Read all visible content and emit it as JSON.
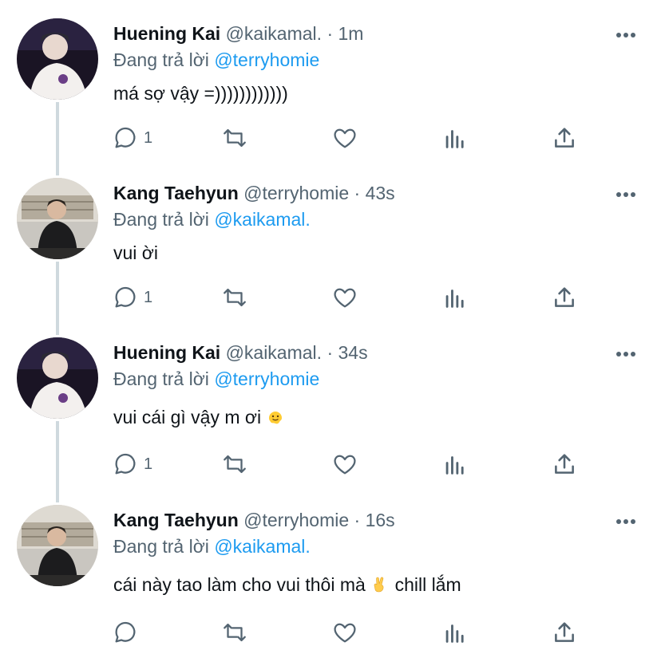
{
  "colors": {
    "link": "#1d9bf0",
    "muted": "#536471",
    "text": "#0f1419",
    "thread_line": "#cfd9de"
  },
  "reply_prefix": "Đang trả lời",
  "tweets": [
    {
      "name": "Huening Kai",
      "handle": "@kaikamal.",
      "time": "· 1m",
      "reply_to": "@terryhomie",
      "text": "má sợ vậy =))))))))))))",
      "emoji": "",
      "text_after": "",
      "reply_count": "1",
      "avatar_icon": "avatar-photo"
    },
    {
      "name": "Kang Taehyun",
      "handle": "@terryhomie",
      "time": "· 43s",
      "reply_to": "@kaikamal.",
      "text": "vui ời",
      "emoji": "",
      "text_after": "",
      "reply_count": "1",
      "avatar_icon": "avatar-photo"
    },
    {
      "name": "Huening Kai",
      "handle": "@kaikamal.",
      "time": "· 34s",
      "reply_to": "@terryhomie",
      "text": "vui cái gì vậy m ơi",
      "emoji": "melting-face-emoji",
      "text_after": "",
      "reply_count": "1",
      "avatar_icon": "avatar-photo"
    },
    {
      "name": "Kang Taehyun",
      "handle": "@terryhomie",
      "time": "· 16s",
      "reply_to": "@kaikamal.",
      "text": "cái này tao làm cho vui thôi mà",
      "emoji": "crossed-fingers-emoji",
      "text_after": "chill lắm",
      "reply_count": "",
      "avatar_icon": "avatar-photo"
    }
  ]
}
